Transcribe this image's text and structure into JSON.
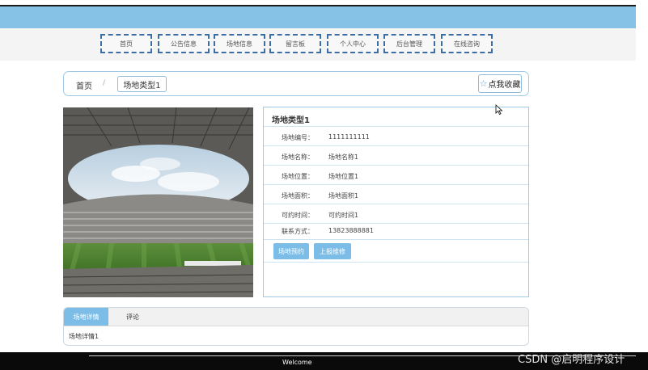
{
  "nav": {
    "items": [
      {
        "label": "首页"
      },
      {
        "label": "公告信息"
      },
      {
        "label": "场地信息"
      },
      {
        "label": "留言板"
      },
      {
        "label": "个人中心"
      },
      {
        "label": "后台管理"
      },
      {
        "label": "在线咨询"
      }
    ]
  },
  "breadcrumb": {
    "home": "首页",
    "separator": "/",
    "current": "场地类型1"
  },
  "favorite": {
    "label": "点我收藏",
    "icon": "star-outline-icon"
  },
  "detail": {
    "title": "场地类型1",
    "rows": [
      {
        "label": "场地编号：",
        "value": "1111111111"
      },
      {
        "label": "场地名称：",
        "value": "场地名称1"
      },
      {
        "label": "场地位置：",
        "value": "场地位置1"
      },
      {
        "label": "场地面积：",
        "value": "场地面积1"
      },
      {
        "label": "可约时间：",
        "value": "可约时间1"
      },
      {
        "label": "联系方式：",
        "value": "13823888881"
      }
    ],
    "actions": {
      "book": "场地预约",
      "report": "上报维修"
    }
  },
  "tabs": {
    "items": [
      {
        "label": "场地详情",
        "active": true
      },
      {
        "label": "评论",
        "active": false
      }
    ],
    "content": "场地详情1"
  },
  "footer": {
    "welcome": "Welcome",
    "watermark": "CSDN @启明程序设计"
  },
  "colors": {
    "banner": "#86c1e6",
    "accent": "#7bbde6",
    "nav_border": "#3a6ea5"
  }
}
